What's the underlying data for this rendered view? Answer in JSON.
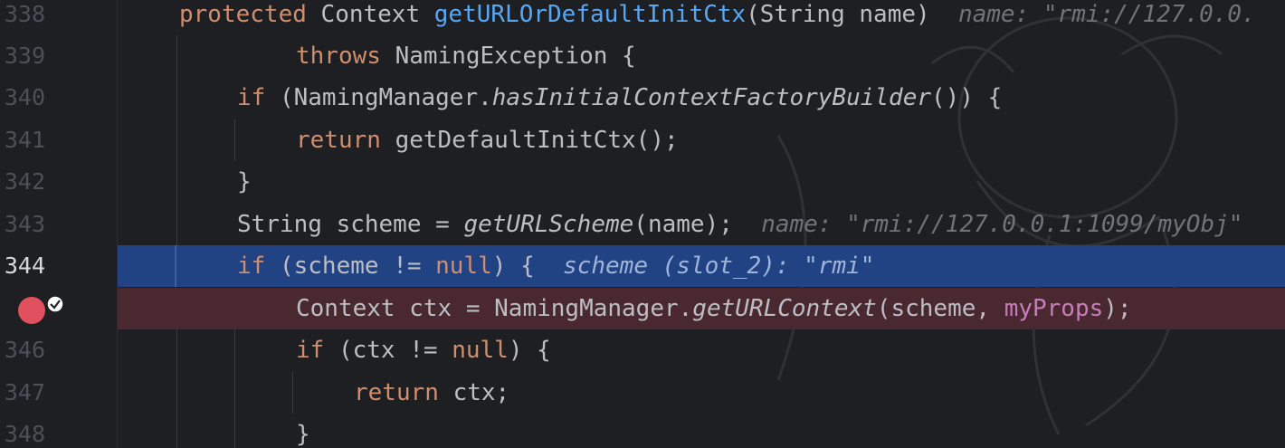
{
  "lines": [
    {
      "num": "338",
      "hint": "name: \"rmi://127.0.0."
    },
    {
      "num": "339"
    },
    {
      "num": "340"
    },
    {
      "num": "341"
    },
    {
      "num": "342"
    },
    {
      "num": "343",
      "hint": "name: \"rmi://127.0.0.1:1099/myObj\""
    },
    {
      "num": "344",
      "hint": "scheme (slot_2): \"rmi\""
    },
    {
      "num": "345"
    },
    {
      "num": "346"
    },
    {
      "num": "347"
    },
    {
      "num": "348"
    }
  ],
  "current_line": "344",
  "breakpoint_line": "345",
  "colors": {
    "background": "#1e1f22",
    "keyword": "#cf8e6d",
    "function": "#56a8f5",
    "field": "#c77dbb",
    "current_line": "#214283",
    "breakpoint_line": "#4a2830",
    "breakpoint_icon": "#e0505e"
  },
  "icons": {
    "breakpoint": "breakpoint-verified-icon"
  }
}
